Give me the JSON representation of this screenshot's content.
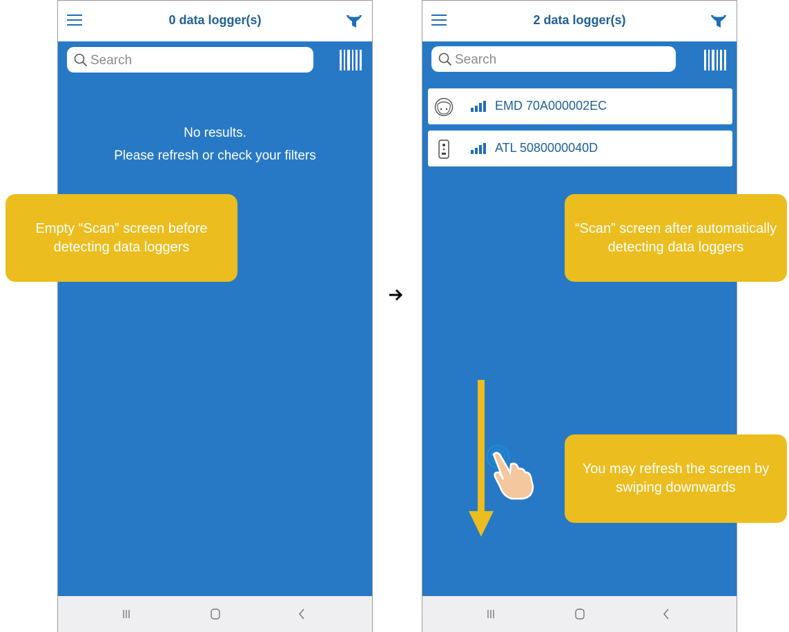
{
  "left_screen": {
    "title": "0 data logger(s)",
    "search_placeholder": "Search",
    "empty_line1": "No results.",
    "empty_line2": "Please refresh or check your filters"
  },
  "right_screen": {
    "title": "2 data logger(s)",
    "search_placeholder": "Search",
    "loggers": [
      {
        "name": "EMD 70A000002EC",
        "icon": "round-logger-icon"
      },
      {
        "name": "ATL 5080000040D",
        "icon": "tag-logger-icon"
      }
    ]
  },
  "annotations": {
    "left_note": "Empty “Scan” screen before detecting data loggers",
    "right_top_note": "“Scan” screen after automatically detecting data loggers",
    "right_bottom_note": "You may refresh the screen by swiping downwards"
  },
  "colors": {
    "accent_blue": "#2879c5",
    "header_text": "#1f5f98",
    "note_yellow": "#ecbd1e"
  }
}
